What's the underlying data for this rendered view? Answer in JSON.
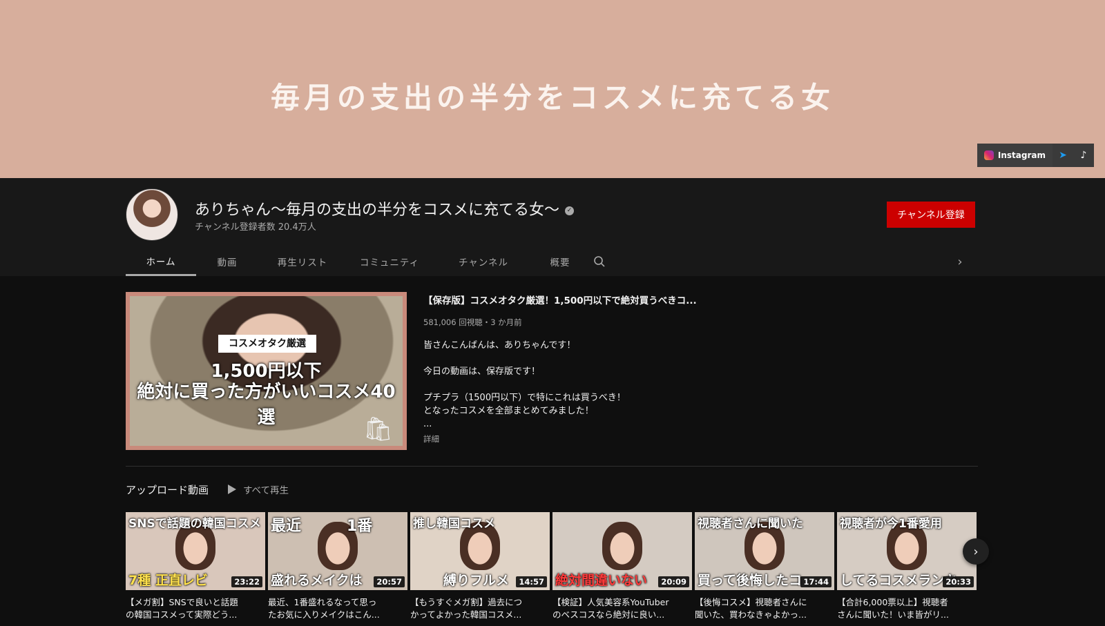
{
  "banner": {
    "title": "毎月の支出の半分をコスメに充てる女",
    "social": {
      "instagram_label": "Instagram"
    }
  },
  "channel": {
    "name": "ありちゃん〜毎月の支出の半分をコスメに充てる女〜",
    "subscribers": "チャンネル登録者数 20.4万人",
    "subscribe_label": "チャンネル登録"
  },
  "tabs": [
    {
      "label": "ホーム",
      "active": true
    },
    {
      "label": "動画"
    },
    {
      "label": "再生リスト"
    },
    {
      "label": "コミュニティ"
    },
    {
      "label": "チャンネル"
    },
    {
      "label": "概要"
    }
  ],
  "featured": {
    "thumb_chip": "コスメオタク厳選",
    "thumb_line1": "1,500円以下",
    "thumb_line2": "絶対に買った方がいいコスメ40選",
    "title": "【保存版】コスメオタク厳選！1,500円以下で絶対買うべきコ...",
    "meta": "581,006 回視聴・3 か月前",
    "desc1": "皆さんこんばんは、ありちゃんです！",
    "desc2": "今日の動画は、保存版です！",
    "desc3": "プチプラ（1500円以下）で特にこれは買うべき！",
    "desc4": "となったコスメを全部まとめてみました！",
    "desc5": "...",
    "more": "詳細"
  },
  "uploads": {
    "title": "アップロード動画",
    "play_all": "すべて再生",
    "videos": [
      {
        "cap_top": "SNSで話題の韓国コスメ",
        "cap_bot": "7種 正直レビ",
        "duration": "23:22",
        "title1": "【メガ割】SNSで良いと話題",
        "title2": "の韓国コスメって実際どう...",
        "bg": "#d9c7bb"
      },
      {
        "cap_top": "最近　　　1番",
        "cap_bot": "盛れるメイクは",
        "duration": "20:57",
        "title1": "最近、1番盛れるなって思っ",
        "title2": "たお気に入りメイクはこん...",
        "bg": "#cdbfb2"
      },
      {
        "cap_top": "推し韓国コスメ",
        "cap_bot": "縛りフルメ",
        "duration": "14:57",
        "title1": "【もうすぐメガ割】過去につ",
        "title2": "かってよかった韓国コスメ...",
        "bg": "#e0d3c6"
      },
      {
        "cap_top": "",
        "cap_bot": "絶対間違いない",
        "duration": "20:09",
        "title1": "【検証】人気美容系YouTuber",
        "title2": "のベスコスなら絶対に良い...",
        "bg": "#d4cbc2"
      },
      {
        "cap_top": "視聴者さんに聞いた",
        "cap_bot": "買って後悔したコ",
        "duration": "17:44",
        "title1": "【後悔コスメ】視聴者さんに",
        "title2": "聞いた、買わなきゃよかっ...",
        "bg": "#cfc6bd"
      },
      {
        "cap_top": "視聴者が今1番愛用",
        "cap_bot": "してるコスメランキ",
        "duration": "20:33",
        "title1": "【合計6,000票以上】視聴者",
        "title2": "さんに聞いた！いま皆がリ...",
        "bg": "#d6ccc3"
      }
    ]
  },
  "colors": {
    "background": "#0f0f0f",
    "header": "#181818",
    "banner": "#d7ae9c",
    "subscribe": "#cc0000"
  }
}
